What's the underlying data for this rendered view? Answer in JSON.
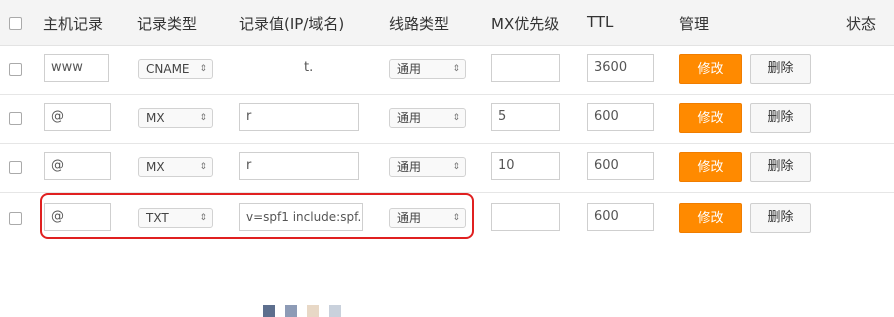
{
  "header": {
    "host": "主机记录",
    "type": "记录类型",
    "value": "记录值(IP/域名)",
    "line": "线路类型",
    "mx": "MX优先级",
    "ttl": "TTL",
    "manage": "管理",
    "status": "状态"
  },
  "rows": [
    {
      "host": "www",
      "type": "CNAME",
      "value": "t.",
      "line": "通用",
      "mx": "",
      "ttl": "3600",
      "edit": "修改",
      "delete": "删除"
    },
    {
      "host": "@",
      "type": "MX",
      "value": "r",
      "line": "通用",
      "mx": "5",
      "ttl": "600",
      "edit": "修改",
      "delete": "删除"
    },
    {
      "host": "@",
      "type": "MX",
      "value": "r",
      "line": "通用",
      "mx": "10",
      "ttl": "600",
      "edit": "修改",
      "delete": "删除"
    },
    {
      "host": "@",
      "type": "TXT",
      "value": "v=spf1 include:spf.",
      "line": "通用",
      "mx": "",
      "ttl": "600",
      "edit": "修改",
      "delete": "删除"
    }
  ],
  "colors": {
    "edit_button": "#ff8a00",
    "highlight_border": "#e02020"
  }
}
